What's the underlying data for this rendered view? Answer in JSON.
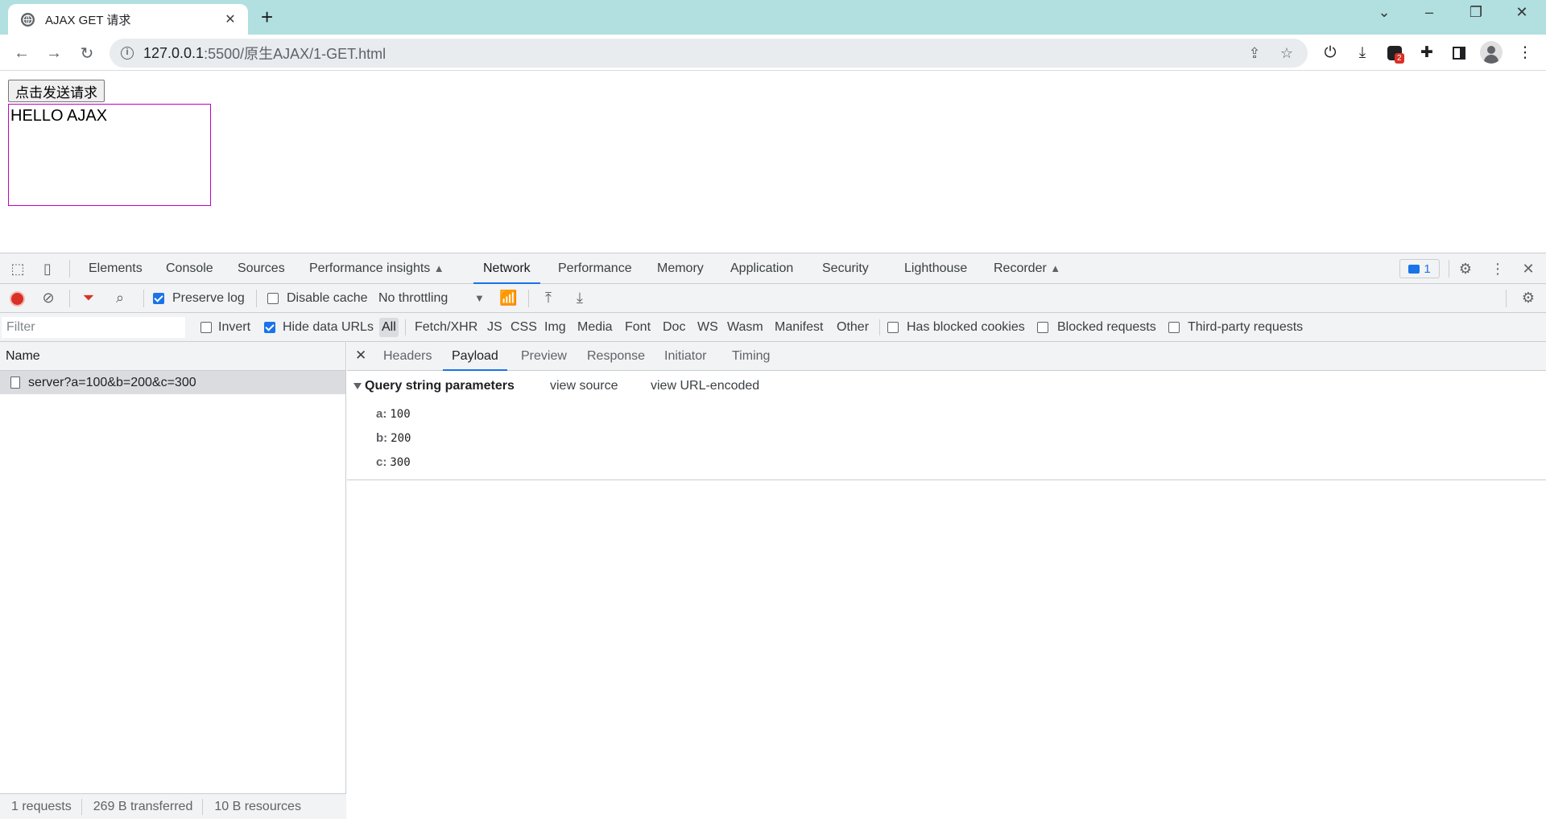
{
  "browser": {
    "tab_title": "AJAX GET 请求",
    "url_host": "127.0.0.1",
    "url_path": ":5500/原生AJAX/1-GET.html",
    "extension_badge": "2"
  },
  "page": {
    "send_button": "点击发送请求",
    "result_text": "HELLO AJAX"
  },
  "devtools": {
    "tabs": [
      "Elements",
      "Console",
      "Sources",
      "Performance insights",
      "Network",
      "Performance",
      "Memory",
      "Application",
      "Security",
      "Lighthouse",
      "Recorder"
    ],
    "active_tab": "Network",
    "issues_count": "1",
    "network_toolbar": {
      "preserve_log": "Preserve log",
      "disable_cache": "Disable cache",
      "throttling": "No throttling"
    },
    "filter": {
      "placeholder": "Filter",
      "invert": "Invert",
      "hide_data_urls": "Hide data URLs",
      "types": [
        "All",
        "Fetch/XHR",
        "JS",
        "CSS",
        "Img",
        "Media",
        "Font",
        "Doc",
        "WS",
        "Wasm",
        "Manifest",
        "Other"
      ],
      "has_blocked_cookies": "Has blocked cookies",
      "blocked_requests": "Blocked requests",
      "third_party": "Third-party requests"
    },
    "request_list": {
      "header": "Name",
      "rows": [
        "server?a=100&b=200&c=300"
      ]
    },
    "status": {
      "requests": "1 requests",
      "transferred": "269 B transferred",
      "resources": "10 B resources"
    },
    "detail": {
      "tabs": [
        "Headers",
        "Payload",
        "Preview",
        "Response",
        "Initiator",
        "Timing"
      ],
      "active_tab": "Payload",
      "section_title": "Query string parameters",
      "view_source": "view source",
      "view_url_encoded": "view URL-encoded",
      "params": [
        {
          "key": "a:",
          "value": "100"
        },
        {
          "key": "b:",
          "value": "200"
        },
        {
          "key": "c:",
          "value": "300"
        }
      ]
    }
  },
  "colors": {
    "titlebar": "#b2dfe0",
    "accent": "#1a73e8",
    "record": "#d93025",
    "result_border": "#c000c0"
  }
}
